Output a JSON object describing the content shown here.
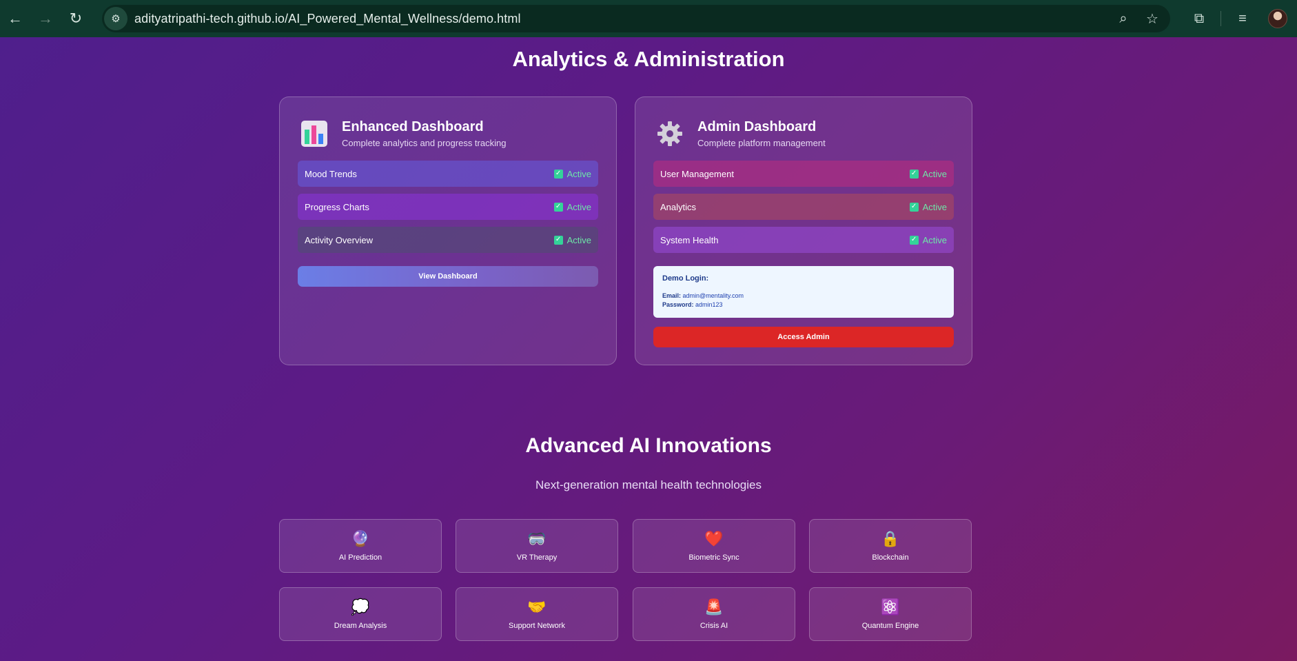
{
  "browser": {
    "url": "adityatripathi-tech.github.io/AI_Powered_Mental_Wellness/demo.html"
  },
  "analytics": {
    "title": "Analytics & Administration",
    "enhanced": {
      "title": "Enhanced Dashboard",
      "desc": "Complete analytics and progress tracking",
      "icon": "bar-chart-icon",
      "features": [
        {
          "label": "Mood Trends",
          "status": "Active"
        },
        {
          "label": "Progress Charts",
          "status": "Active"
        },
        {
          "label": "Activity Overview",
          "status": "Active"
        }
      ],
      "button": "View Dashboard"
    },
    "admin": {
      "title": "Admin Dashboard",
      "desc": "Complete platform management",
      "icon": "gear-icon",
      "features": [
        {
          "label": "User Management",
          "status": "Active"
        },
        {
          "label": "Analytics",
          "status": "Active"
        },
        {
          "label": "System Health",
          "status": "Active"
        }
      ],
      "demo": {
        "title": "Demo Login:",
        "email_label": "Email:",
        "email": "admin@mentality.com",
        "password_label": "Password:",
        "password": "admin123"
      },
      "button": "Access Admin"
    }
  },
  "innovations": {
    "title": "Advanced AI Innovations",
    "subtitle": "Next-generation mental health technologies",
    "tiles": [
      {
        "label": "AI Prediction",
        "icon": "crystal-ball-icon",
        "glyph": "🔮"
      },
      {
        "label": "VR Therapy",
        "icon": "vr-goggles-icon",
        "glyph": "🥽"
      },
      {
        "label": "Biometric Sync",
        "icon": "heart-icon",
        "glyph": "❤️"
      },
      {
        "label": "Blockchain",
        "icon": "lock-icon",
        "glyph": "🔒"
      },
      {
        "label": "Dream Analysis",
        "icon": "thought-bubble-icon",
        "glyph": "💭"
      },
      {
        "label": "Support Network",
        "icon": "handshake-icon",
        "glyph": "🤝"
      },
      {
        "label": "Crisis AI",
        "icon": "siren-icon",
        "glyph": "🚨"
      },
      {
        "label": "Quantum Engine",
        "icon": "atom-icon",
        "glyph": "⚛️"
      }
    ]
  },
  "colors": {
    "accent_green": "#34d399",
    "admin_red": "#dc2626",
    "view_blue": "#6b7ee6"
  }
}
